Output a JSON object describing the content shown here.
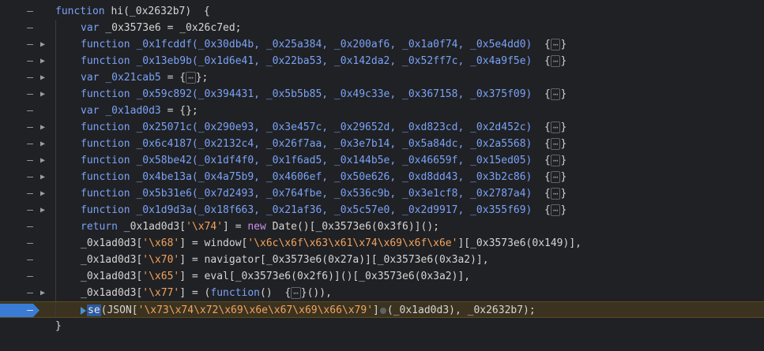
{
  "lines": [
    {
      "dash": "–",
      "fold": "",
      "code": [
        [
          "kw",
          "function "
        ],
        [
          "id",
          "hi"
        ],
        [
          "id",
          "(_0x2632b7)  {"
        ]
      ]
    },
    {
      "dash": "–",
      "fold": "",
      "code": [
        [
          "kw",
          "var "
        ],
        [
          "id",
          "_0x3573e6 = _0x26c7ed;"
        ]
      ]
    },
    {
      "dash": "–",
      "fold": "▶",
      "code": [
        [
          "kw",
          "function "
        ],
        [
          "fn",
          "_0x1fcddf"
        ],
        [
          "fn",
          "(_0x30db4b, _0x25a384, _0x200af6, _0x1a0f74, _0x5e4dd0)"
        ],
        [
          "id",
          "  {"
        ],
        [
          "ell",
          "⋯"
        ],
        [
          "id",
          "}"
        ]
      ]
    },
    {
      "dash": "–",
      "fold": "▶",
      "code": [
        [
          "kw",
          "function "
        ],
        [
          "fn",
          "_0x13eb9b"
        ],
        [
          "fn",
          "(_0x1d6e41, _0x22ba53, _0x142da2, _0x52ff7c, _0x4a9f5e)"
        ],
        [
          "id",
          "  {"
        ],
        [
          "ell",
          "⋯"
        ],
        [
          "id",
          "}"
        ]
      ]
    },
    {
      "dash": "–",
      "fold": "▶",
      "code": [
        [
          "kw",
          "var "
        ],
        [
          "fn",
          "_0x21cab5"
        ],
        [
          "id",
          " = {"
        ],
        [
          "ell",
          "⋯"
        ],
        [
          "id",
          "};"
        ]
      ]
    },
    {
      "dash": "–",
      "fold": "▶",
      "code": [
        [
          "kw",
          "function "
        ],
        [
          "fn",
          "_0x59c892"
        ],
        [
          "fn",
          "(_0x394431, _0x5b5b85, _0x49c33e, _0x367158, _0x375f09)"
        ],
        [
          "id",
          "  {"
        ],
        [
          "ell",
          "⋯"
        ],
        [
          "id",
          "}"
        ]
      ]
    },
    {
      "dash": "–",
      "fold": "",
      "code": [
        [
          "kw",
          "var "
        ],
        [
          "fn",
          "_0x1ad0d3"
        ],
        [
          "id",
          " = {};"
        ]
      ]
    },
    {
      "dash": "–",
      "fold": "▶",
      "code": [
        [
          "kw",
          "function "
        ],
        [
          "fn",
          "_0x25071c"
        ],
        [
          "fn",
          "(_0x290e93, _0x3e457c, _0x29652d, _0xd823cd, _0x2d452c)"
        ],
        [
          "id",
          "  {"
        ],
        [
          "ell",
          "⋯"
        ],
        [
          "id",
          "}"
        ]
      ]
    },
    {
      "dash": "–",
      "fold": "▶",
      "code": [
        [
          "kw",
          "function "
        ],
        [
          "fn",
          "_0x6c4187"
        ],
        [
          "fn",
          "(_0x2132c4, _0x26f7aa, _0x3e7b14, _0x5a84dc, _0x2a5568)"
        ],
        [
          "id",
          "  {"
        ],
        [
          "ell",
          "⋯"
        ],
        [
          "id",
          "}"
        ]
      ]
    },
    {
      "dash": "–",
      "fold": "▶",
      "code": [
        [
          "kw",
          "function "
        ],
        [
          "fn",
          "_0x58be42"
        ],
        [
          "fn",
          "(_0x1df4f0, _0x1f6ad5, _0x144b5e, _0x46659f, _0x15ed05)"
        ],
        [
          "id",
          "  {"
        ],
        [
          "ell",
          "⋯"
        ],
        [
          "id",
          "}"
        ]
      ]
    },
    {
      "dash": "–",
      "fold": "▶",
      "code": [
        [
          "kw",
          "function "
        ],
        [
          "fn",
          "_0x4be13a"
        ],
        [
          "fn",
          "(_0x4a75b9, _0x4606ef, _0x50e626, _0xd8dd43, _0x3b2c86)"
        ],
        [
          "id",
          "  {"
        ],
        [
          "ell",
          "⋯"
        ],
        [
          "id",
          "}"
        ]
      ]
    },
    {
      "dash": "–",
      "fold": "▶",
      "code": [
        [
          "kw",
          "function "
        ],
        [
          "fn",
          "_0x5b31e6"
        ],
        [
          "fn",
          "(_0x7d2493, _0x764fbe, _0x536c9b, _0x3e1cf8, _0x2787a4)"
        ],
        [
          "id",
          "  {"
        ],
        [
          "ell",
          "⋯"
        ],
        [
          "id",
          "}"
        ]
      ]
    },
    {
      "dash": "–",
      "fold": "▶",
      "code": [
        [
          "kw",
          "function "
        ],
        [
          "fn",
          "_0x1d9d3a"
        ],
        [
          "fn",
          "(_0x18f663, _0x21af36, _0x5c57e0, _0x2d9917, _0x355f69)"
        ],
        [
          "id",
          "  {"
        ],
        [
          "ell",
          "⋯"
        ],
        [
          "id",
          "}"
        ]
      ]
    },
    {
      "dash": "–",
      "fold": "",
      "code": [
        [
          "kw",
          "return "
        ],
        [
          "id",
          "_0x1ad0d3["
        ],
        [
          "str",
          "'\\x74'"
        ],
        [
          "id",
          "] = "
        ],
        [
          "kw2",
          "new "
        ],
        [
          "id",
          "Date()[_0x3573e6(0x3f6)]();"
        ]
      ]
    },
    {
      "dash": "–",
      "fold": "",
      "code": [
        [
          "id",
          "_0x1ad0d3["
        ],
        [
          "str",
          "'\\x68'"
        ],
        [
          "id",
          "] = window["
        ],
        [
          "str",
          "'\\x6c\\x6f\\x63\\x61\\x74\\x69\\x6f\\x6e'"
        ],
        [
          "id",
          "][_0x3573e6(0x149)],"
        ]
      ]
    },
    {
      "dash": "–",
      "fold": "",
      "code": [
        [
          "id",
          "_0x1ad0d3["
        ],
        [
          "str",
          "'\\x70'"
        ],
        [
          "id",
          "] = navigator[_0x3573e6(0x27a)][_0x3573e6(0x3a2)],"
        ]
      ]
    },
    {
      "dash": "–",
      "fold": "",
      "code": [
        [
          "id",
          "_0x1ad0d3["
        ],
        [
          "str",
          "'\\x65'"
        ],
        [
          "id",
          "] = eval[_0x3573e6(0x2f6)]()[_0x3573e6(0x3a2)],"
        ]
      ]
    },
    {
      "dash": "–",
      "fold": "▶",
      "code": [
        [
          "id",
          "_0x1ad0d3["
        ],
        [
          "str",
          "'\\x77'"
        ],
        [
          "id",
          "] = ("
        ],
        [
          "kw",
          "function"
        ],
        [
          "id",
          "()  {"
        ],
        [
          "ell",
          "⋯"
        ],
        [
          "id",
          "}()),"
        ]
      ]
    },
    {
      "dash": "–",
      "fold": "",
      "active": true,
      "code": [
        [
          "step",
          ""
        ],
        [
          "se",
          "se"
        ],
        [
          "id",
          "(JSON["
        ],
        [
          "str",
          "'\\x73\\x74\\x72\\x69\\x6e\\x67\\x69\\x66\\x79'"
        ],
        [
          "id",
          "]"
        ],
        [
          "dot",
          ""
        ],
        [
          "id",
          "(_0x1ad0d3), _0x2632b7);"
        ]
      ]
    },
    {
      "dash": "",
      "fold": "",
      "code": [
        [
          "id",
          "}"
        ]
      ]
    },
    {
      "dash": "",
      "fold": "",
      "code": [
        [
          "id",
          ""
        ]
      ]
    }
  ]
}
